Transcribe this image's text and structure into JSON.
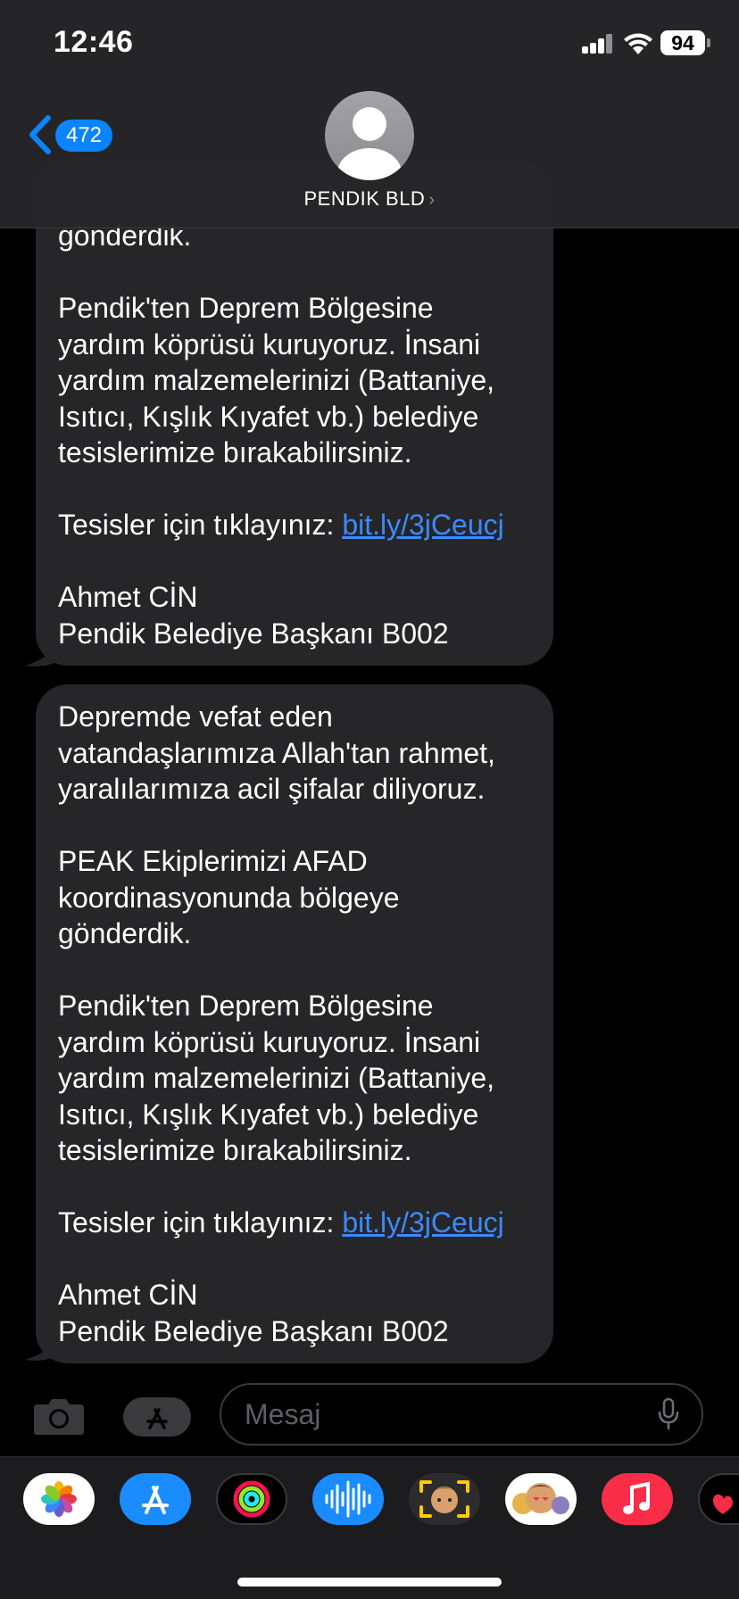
{
  "status_bar": {
    "time": "12:46",
    "battery": "94"
  },
  "header": {
    "back_count": "472",
    "contact_name": "PENDIK BLD"
  },
  "messages": [
    {
      "paragraphs": [
        "gönderdik.",
        "Pendik'ten Deprem Bölgesine\nyardım köprüsü kuruyoruz. İnsani\nyardım malzemelerinizi (Battaniye,\nIsıtıcı, Kışlık Kıyafet vb.) belediye\ntesislerimize bırakabilirsiniz."
      ],
      "link_prefix": "Tesisler için tıklayınız: ",
      "link": "bit.ly/3jCeucj",
      "signature": "Ahmet CİN\nPendik Belediye Başkanı B002"
    },
    {
      "paragraphs": [
        "Depremde vefat eden\nvatandaşlarımıza Allah'tan rahmet,\nyaralılarımıza acil şifalar diliyoruz.",
        "PEAK Ekiplerimizi AFAD\nkoordinasyonunda bölgeye\ngönderdik.",
        "Pendik'ten Deprem Bölgesine\nyardım köprüsü kuruyoruz. İnsani\nyardım malzemelerinizi (Battaniye,\nIsıtıcı, Kışlık Kıyafet vb.) belediye\ntesislerimize bırakabilirsiniz."
      ],
      "link_prefix": "Tesisler için tıklayınız: ",
      "link": "bit.ly/3jCeucj",
      "signature": "Ahmet CİN\nPendik Belediye Başkanı B002"
    }
  ],
  "composer": {
    "placeholder": "Mesaj"
  },
  "app_drawer": {
    "apps": [
      "photos-icon",
      "app-store-icon",
      "activity-icon",
      "audio-message-icon",
      "memoji-stickers-icon",
      "animoji-icon",
      "music-icon",
      "digital-touch-icon"
    ]
  },
  "colors": {
    "bubble": "#262628",
    "link": "#3b8bff",
    "accent": "#0a84ff"
  }
}
